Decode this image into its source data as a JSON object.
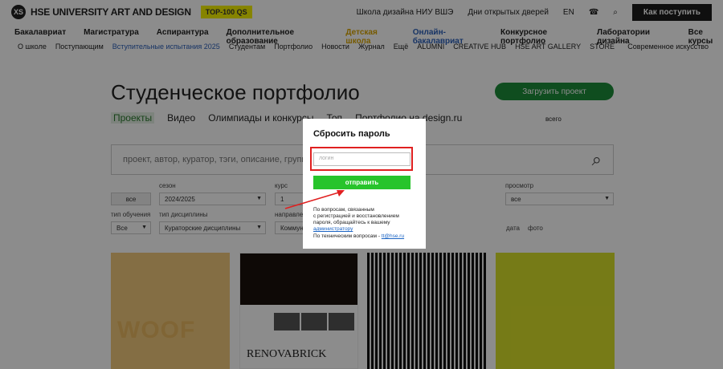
{
  "header": {
    "logo_mark": "ХS",
    "logo_text": "HSE UNIVERSITY ART AND DESIGN",
    "badge": "TOP-100 QS",
    "school_link": "Школа дизайна НИУ ВШЭ",
    "open_days": "Дни открытых дверей",
    "lang": "EN",
    "cta": "Как поступить"
  },
  "nav_primary": [
    "Бакалавриат",
    "Магистратура",
    "Аспирантура",
    "Дополнительное образование",
    "Детская школа",
    "Онлайн-бакалавриат",
    "Конкурсное портфолио",
    "Лаборатории дизайна",
    "Все курсы"
  ],
  "nav_secondary": [
    "О школе",
    "Поступающим",
    "Вступительные испытания 2025",
    "Студентам",
    "Портфолио",
    "Новости",
    "Журнал",
    "Ещё",
    "ALUMNI",
    "CREATIVE HUB",
    "HSE ART GALLERY",
    "STORE"
  ],
  "nav_secondary_right": "Современное искусство",
  "page": {
    "title": "Студенческое портфолио",
    "upload": "Загрузить проект",
    "tabs": [
      "Проекты",
      "Видео",
      "Олимпиады и конкурсы",
      "Топ",
      "Портфолио на design.ru"
    ],
    "tabs_right": "всего",
    "search_placeholder": "проект, автор, куратор, тэги, описание, группа"
  },
  "filters": {
    "row1_labels": [
      "сезон",
      "курс",
      "просмотр"
    ],
    "row1_values": [
      "все",
      "2024/2025",
      "1",
      "все"
    ],
    "row2_labels": [
      "тип обучения",
      "тип дисциплины",
      "направление"
    ],
    "row2_values": [
      "Все",
      "Кураторские дисциплины",
      "Коммуникационный дизайн"
    ],
    "sort": [
      "дата",
      "фото"
    ]
  },
  "cards": {
    "card1_text": "WOOF",
    "card2_text": "RENOVABRICK"
  },
  "modal": {
    "title": "Сбросить пароль",
    "placeholder": "логин",
    "submit": "отправить",
    "help_line1": "По вопросам, связанным",
    "help_line2": "с регистрацией и восстановлением",
    "help_line3": "пароля, обращайтесь к вашему",
    "help_link": "администратору",
    "tech_prefix": "По техническим вопросам - ",
    "tech_email": "tt@hse.ru"
  },
  "colors": {
    "accent_green": "#27c42b",
    "annotation_red": "#e02020"
  }
}
